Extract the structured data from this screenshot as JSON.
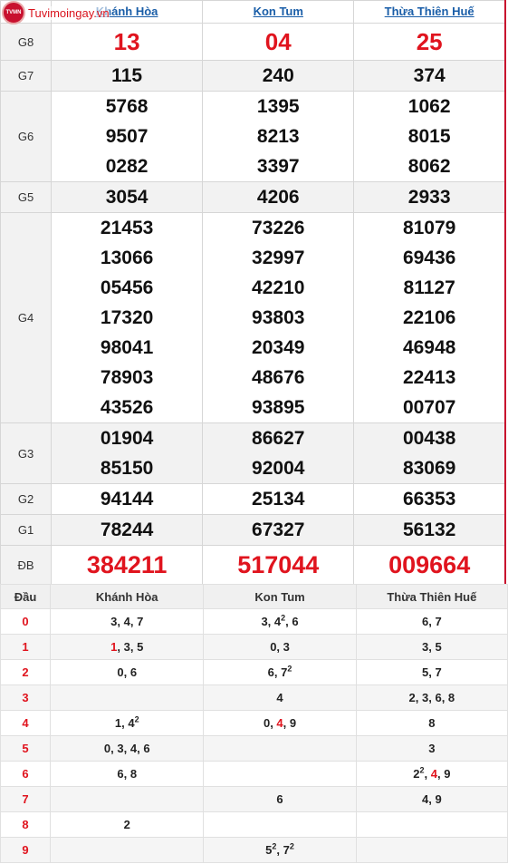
{
  "logo_text": "Tuvimoingay.vn",
  "provinces": [
    "Khánh Hòa",
    "Kon Tum",
    "Thừa Thiên Huế"
  ],
  "results": [
    {
      "label": "G8",
      "values": [
        [
          "13"
        ],
        [
          "04"
        ],
        [
          "25"
        ]
      ]
    },
    {
      "label": "G7",
      "values": [
        [
          "115"
        ],
        [
          "240"
        ],
        [
          "374"
        ]
      ]
    },
    {
      "label": "G6",
      "values": [
        [
          "5768",
          "9507",
          "0282"
        ],
        [
          "1395",
          "8213",
          "3397"
        ],
        [
          "1062",
          "8015",
          "8062"
        ]
      ]
    },
    {
      "label": "G5",
      "values": [
        [
          "3054"
        ],
        [
          "4206"
        ],
        [
          "2933"
        ]
      ]
    },
    {
      "label": "G4",
      "values": [
        [
          "21453",
          "13066",
          "05456",
          "17320",
          "98041",
          "78903",
          "43526"
        ],
        [
          "73226",
          "32997",
          "42210",
          "93803",
          "20349",
          "48676",
          "93895"
        ],
        [
          "81079",
          "69436",
          "81127",
          "22106",
          "46948",
          "22413",
          "00707"
        ]
      ]
    },
    {
      "label": "G3",
      "values": [
        [
          "01904",
          "85150"
        ],
        [
          "86627",
          "92004"
        ],
        [
          "00438",
          "83069"
        ]
      ]
    },
    {
      "label": "G2",
      "values": [
        [
          "94144"
        ],
        [
          "25134"
        ],
        [
          "66353"
        ]
      ]
    },
    {
      "label": "G1",
      "values": [
        [
          "78244"
        ],
        [
          "67327"
        ],
        [
          "56132"
        ]
      ]
    },
    {
      "label": "ĐB",
      "values": [
        [
          "384211"
        ],
        [
          "517044"
        ],
        [
          "009664"
        ]
      ]
    }
  ],
  "dau_table": {
    "header": [
      "Đầu",
      "Khánh Hòa",
      "Kon Tum",
      "Thừa Thiên Huế"
    ],
    "rows": [
      {
        "digit": "0",
        "cells": [
          [
            {
              "t": "3"
            },
            {
              "t": "4"
            },
            {
              "t": "7"
            }
          ],
          [
            {
              "t": "3"
            },
            {
              "t": "4",
              "sup": "2"
            },
            {
              "t": "6"
            }
          ],
          [
            {
              "t": "6"
            },
            {
              "t": "7"
            }
          ]
        ]
      },
      {
        "digit": "1",
        "cells": [
          [
            {
              "t": "1",
              "red": true
            },
            {
              "t": "3"
            },
            {
              "t": "5"
            }
          ],
          [
            {
              "t": "0"
            },
            {
              "t": "3"
            }
          ],
          [
            {
              "t": "3"
            },
            {
              "t": "5"
            }
          ]
        ]
      },
      {
        "digit": "2",
        "cells": [
          [
            {
              "t": "0"
            },
            {
              "t": "6"
            }
          ],
          [
            {
              "t": "6"
            },
            {
              "t": "7",
              "sup": "2"
            }
          ],
          [
            {
              "t": "5"
            },
            {
              "t": "7"
            }
          ]
        ]
      },
      {
        "digit": "3",
        "cells": [
          [],
          [
            {
              "t": "4"
            }
          ],
          [
            {
              "t": "2"
            },
            {
              "t": "3"
            },
            {
              "t": "6"
            },
            {
              "t": "8"
            }
          ]
        ]
      },
      {
        "digit": "4",
        "cells": [
          [
            {
              "t": "1"
            },
            {
              "t": "4",
              "sup": "2"
            }
          ],
          [
            {
              "t": "0"
            },
            {
              "t": "4",
              "red": true
            },
            {
              "t": "9"
            }
          ],
          [
            {
              "t": "8"
            }
          ]
        ]
      },
      {
        "digit": "5",
        "cells": [
          [
            {
              "t": "0"
            },
            {
              "t": "3"
            },
            {
              "t": "4"
            },
            {
              "t": "6"
            }
          ],
          [],
          [
            {
              "t": "3"
            }
          ]
        ]
      },
      {
        "digit": "6",
        "cells": [
          [
            {
              "t": "6"
            },
            {
              "t": "8"
            }
          ],
          [],
          [
            {
              "t": "2",
              "sup": "2"
            },
            {
              "t": "4",
              "red": true
            },
            {
              "t": "9"
            }
          ]
        ]
      },
      {
        "digit": "7",
        "cells": [
          [],
          [
            {
              "t": "6"
            }
          ],
          [
            {
              "t": "4"
            },
            {
              "t": "9"
            }
          ]
        ]
      },
      {
        "digit": "8",
        "cells": [
          [
            {
              "t": "2"
            }
          ],
          [],
          []
        ]
      },
      {
        "digit": "9",
        "cells": [
          [],
          [
            {
              "t": "5",
              "sup": "2"
            },
            {
              "t": "7",
              "sup": "2"
            }
          ],
          []
        ]
      }
    ]
  }
}
